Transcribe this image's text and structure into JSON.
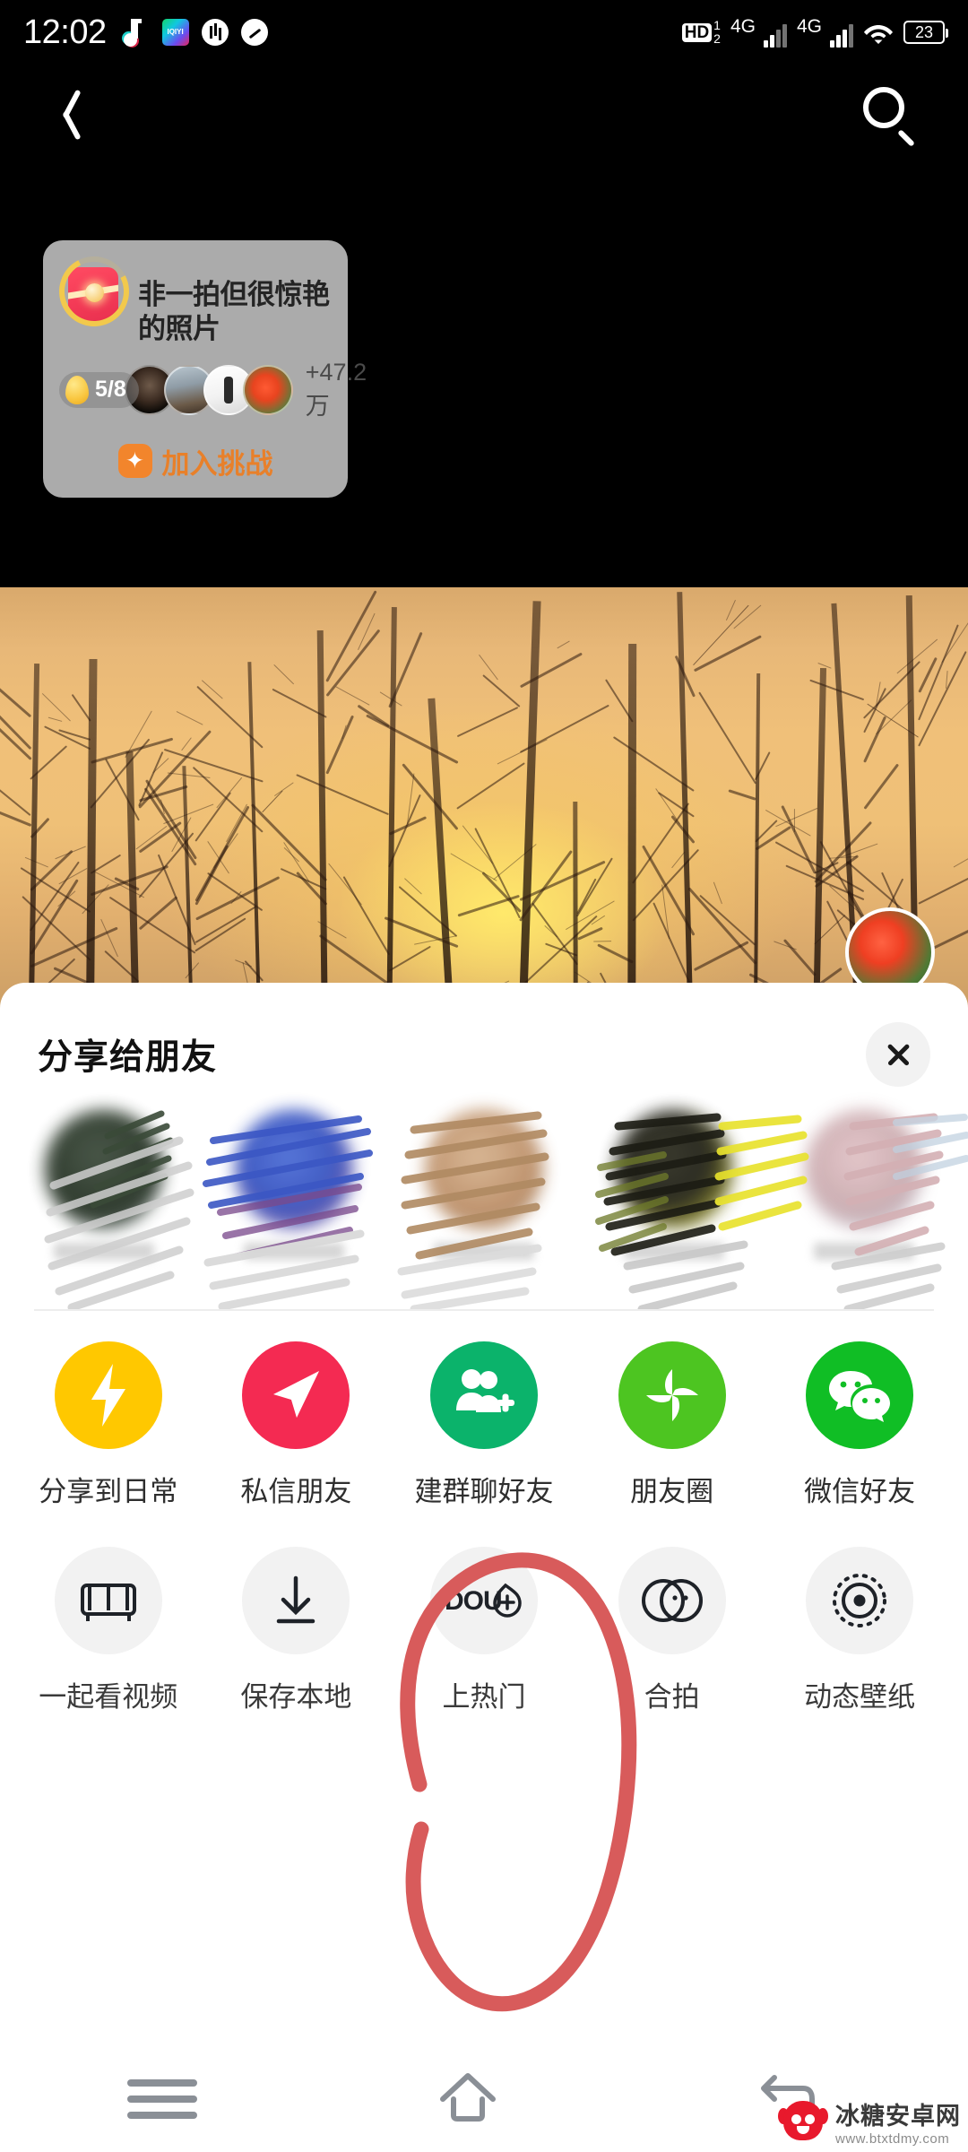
{
  "statusbar": {
    "time": "12:02",
    "icons": [
      "tiktok-icon",
      "iqiyi-icon",
      "equalizer-icon",
      "speed-icon"
    ],
    "hd_label": "HD",
    "hd_sim1": "1",
    "hd_sim2": "2",
    "network_1": "4G",
    "network_2": "4G",
    "wifi": "wifi-icon",
    "battery": "23"
  },
  "topnav": {
    "back": "back-chevron-icon",
    "search": "search-icon"
  },
  "challenge": {
    "title": "非一拍但很惊艳的照片",
    "progress": "5/8",
    "participants": "+47.2万",
    "join_label": "加入挑战",
    "egg_icon": "golden-egg-icon",
    "gift_icon": "red-gift-icon"
  },
  "sheet": {
    "title": "分享给朋友",
    "close": "close-icon",
    "friends": [
      {
        "name_masked": true
      },
      {
        "name_masked": true
      },
      {
        "name_masked": true
      },
      {
        "name_masked": true
      },
      {
        "name_masked": true
      }
    ],
    "row1": [
      {
        "label": "分享到日常",
        "icon": "lightning-bolt-icon",
        "color": "#FFC800"
      },
      {
        "label": "私信朋友",
        "icon": "paper-plane-icon",
        "color": "#F42A52"
      },
      {
        "label": "建群聊好友",
        "icon": "add-person-icon",
        "color": "#0BB36B"
      },
      {
        "label": "朋友圈",
        "icon": "qzone-aperture-icon",
        "color": "#4DC521"
      },
      {
        "label": "微信好友",
        "icon": "wechat-icon",
        "color": "#10BE25"
      }
    ],
    "row2": [
      {
        "label": "一起看视频",
        "icon": "sofa-icon",
        "color": "#F2F2F2"
      },
      {
        "label": "保存本地",
        "icon": "download-arrow-icon",
        "color": "#F2F2F2"
      },
      {
        "label": "上热门",
        "icon": "dou-plus-icon",
        "color": "#F2F2F2"
      },
      {
        "label": "合拍",
        "icon": "duet-circles-icon",
        "color": "#F2F2F2"
      },
      {
        "label": "动态壁纸",
        "icon": "live-wallpaper-icon",
        "color": "#F2F2F2"
      }
    ]
  },
  "navbar": {
    "menu": "menu-icon",
    "home": "home-icon",
    "back": "back-arrow-icon"
  },
  "watermark": {
    "site_name": "冰糖安卓网",
    "url": "www.btxtdmy.com"
  },
  "annotation": {
    "type": "hand-drawn-red-circle",
    "target": "上热门",
    "color": "#D85B5B"
  }
}
